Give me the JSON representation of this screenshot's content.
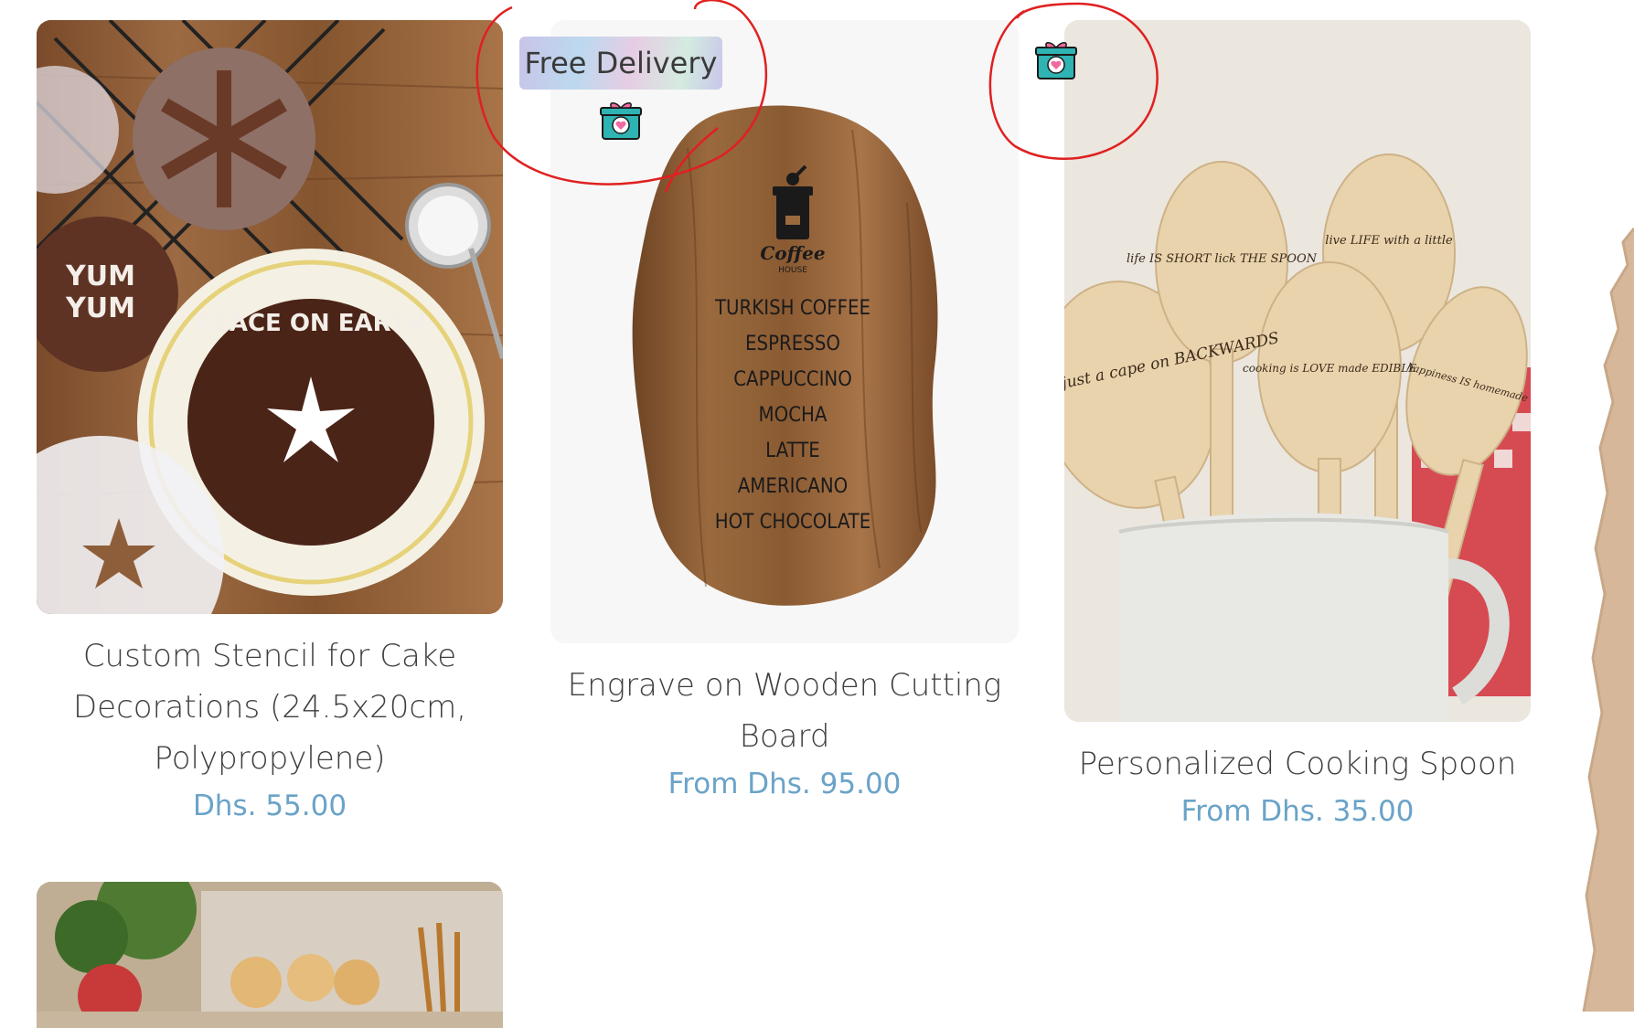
{
  "products": [
    {
      "title_line1": "Custom Stencil for Cake",
      "title_line2": "Decorations (24.5x20cm,",
      "title_line3": "Polypropylene)",
      "price": "Dhs. 55.00"
    },
    {
      "title_line1": "Engrave on Wooden Cutting",
      "title_line2": "Board",
      "price": "From Dhs. 95.00",
      "badge": "Free Delivery"
    },
    {
      "title_line1": "Personalized Cooking Spoon",
      "price": "From Dhs. 35.00"
    }
  ],
  "stencil_image": {
    "texts": {
      "yum1": "YUM",
      "yum2": "YUM",
      "peace": "PEACE ON EARTH"
    }
  },
  "board_image": {
    "logo": "Coffee",
    "logo_sub": "HOUSE",
    "menu": [
      "TURKISH COFFEE",
      "ESPRESSO",
      "CAPPUCCINO",
      "MOCHA",
      "LATTE",
      "AMERICANO",
      "HOT CHOCOLATE"
    ]
  },
  "spoon_image": {
    "spoon1": "an APRON is just a cape on BACKWARDS",
    "spoon2": "life IS SHORT lick THE SPOON",
    "spoon3": "cooking is LOVE made EDIBLE",
    "spoon4": "live LIFE with a little",
    "spoon5": "happiness IS homemade"
  },
  "colors": {
    "price": "#6aa3c8",
    "title": "#3f3f3f",
    "annotation": "#e02020"
  },
  "icons": [
    "gift-heart-icon"
  ]
}
